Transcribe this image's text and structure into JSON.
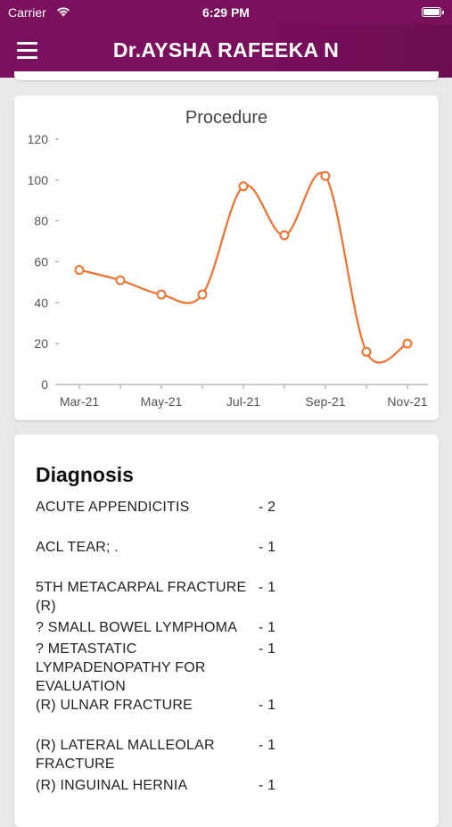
{
  "status_bar": {
    "carrier": "Carrier",
    "time": "6:29 PM"
  },
  "header": {
    "title": "Dr.AYSHA RAFEEKA N"
  },
  "chart_data": {
    "type": "line",
    "title": "Procedure",
    "x": [
      "Mar-21",
      "Apr-21",
      "May-21",
      "Jun-21",
      "Jul-21",
      "Aug-21",
      "Sep-21",
      "Oct-21",
      "Nov-21"
    ],
    "values": [
      56,
      51,
      44,
      44,
      97,
      73,
      102,
      16,
      20
    ],
    "x_tick_labels": [
      "Mar-21",
      "May-21",
      "Jul-21",
      "Sep-21",
      "Nov-21"
    ],
    "y_ticks": [
      "0",
      "20",
      "40",
      "60",
      "80",
      "100",
      "120"
    ],
    "ylim": [
      0,
      120
    ],
    "line_color": "#f07030",
    "grid": false,
    "legend": "none"
  },
  "diagnosis": {
    "title": "Diagnosis",
    "items": [
      {
        "name": "ACUTE APPENDICITIS",
        "count": "- 2"
      },
      {
        "name": "ACL TEAR; .",
        "count": "- 1"
      },
      {
        "name": "5TH METACARPAL FRACTURE (R)",
        "count": "- 1"
      },
      {
        "name": "? SMALL BOWEL LYMPHOMA",
        "count": "- 1"
      },
      {
        "name": "? METASTATIC LYMPADENOPATHY FOR EVALUATION",
        "count": "- 1"
      },
      {
        "name": "(R) ULNAR FRACTURE",
        "count": "- 1"
      },
      {
        "name": "(R) LATERAL MALLEOLAR FRACTURE",
        "count": "- 1"
      },
      {
        "name": "(R) INGUINAL HERNIA",
        "count": "- 1"
      }
    ]
  }
}
